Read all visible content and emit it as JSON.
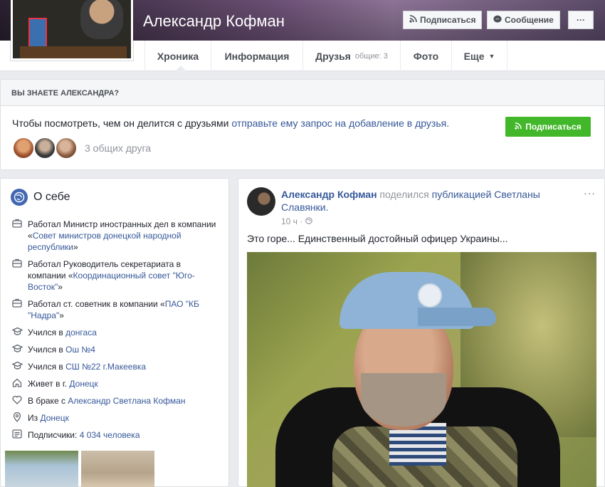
{
  "header": {
    "name": "Александр Кофман",
    "subscribe_label": "Подписаться",
    "message_label": "Сообщение",
    "more_label": "···"
  },
  "tabs": [
    {
      "label": "Хроника"
    },
    {
      "label": "Информация"
    },
    {
      "label": "Друзья",
      "sub": "общие: 3"
    },
    {
      "label": "Фото"
    },
    {
      "label": "Еще"
    }
  ],
  "know": {
    "title": "ВЫ ЗНАЕТЕ АЛЕКСАНДРА?",
    "text_prefix": "Чтобы посмотреть, чем он делится с друзьями",
    "text_link": "отправьте ему запрос на добавление в друзья.",
    "button_label": "Подписаться",
    "mutual_text": "3 общих друга"
  },
  "about": {
    "title": "О себе",
    "items": [
      {
        "icon": "briefcase-icon",
        "prefix": "Работал Министр иностранных дел в компании «",
        "link": "Совет министров донецкой народной республики",
        "suffix": "»"
      },
      {
        "icon": "briefcase-icon",
        "prefix": "Работал Руководитель секретариата в компании «",
        "link": "Координационный совет \"Юго-Восток\"",
        "suffix": "»"
      },
      {
        "icon": "briefcase-icon",
        "prefix": "Работал ст. советник в компании «",
        "link": "ПАО \"КБ \"Надра\"",
        "suffix": "»"
      },
      {
        "icon": "graduation-cap-icon",
        "prefix": "Учился в ",
        "link": "донгаса",
        "suffix": ""
      },
      {
        "icon": "graduation-cap-icon",
        "prefix": "Учился в ",
        "link": "Ош №4",
        "suffix": ""
      },
      {
        "icon": "graduation-cap-icon",
        "prefix": "Учился в ",
        "link": "СШ №22 г.Макеевка",
        "suffix": ""
      },
      {
        "icon": "home-icon",
        "prefix": "Живет в г. ",
        "link": "Донецк",
        "suffix": ""
      },
      {
        "icon": "heart-icon",
        "prefix": "В браке с ",
        "link": "Александр Светлана Кофман",
        "suffix": ""
      },
      {
        "icon": "location-pin-icon",
        "prefix": "Из ",
        "link": "Донецк",
        "suffix": ""
      },
      {
        "icon": "followers-icon",
        "prefix": "Подписчики: ",
        "link": "4 034 человека",
        "suffix": ""
      }
    ]
  },
  "post": {
    "author": "Александр Кофман",
    "action": "поделился",
    "target": "публикацией Светланы Славянки.",
    "time": "10 ч",
    "audience_icon": "globe-icon",
    "text": "Это горе... Единственный достойный офицер Украины..."
  },
  "colors": {
    "link": "#365899",
    "green": "#42b72a",
    "background": "#e9ebee"
  }
}
